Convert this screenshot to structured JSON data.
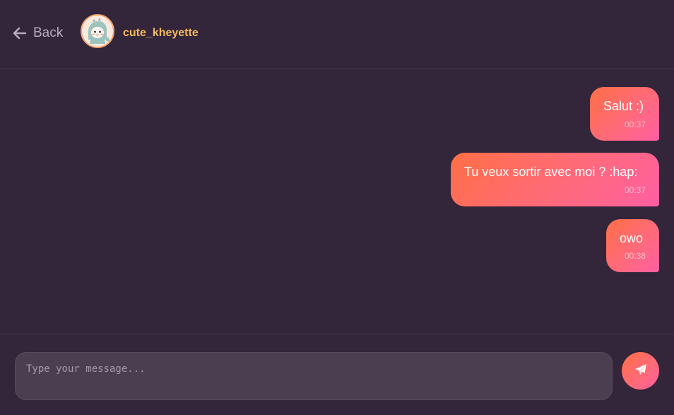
{
  "header": {
    "back_label": "Back",
    "username": "cute_kheyette"
  },
  "messages": [
    {
      "text": "Salut :)",
      "time": "00:37"
    },
    {
      "text": "Tu veux sortir avec moi ? :hap:",
      "time": "00:37"
    },
    {
      "text": "owo",
      "time": "00:38"
    }
  ],
  "composer": {
    "value": "",
    "placeholder": "Type your message..."
  },
  "icons": {
    "back": "arrow-left-icon",
    "send": "paper-plane-icon"
  },
  "colors": {
    "background": "#33253a",
    "username": "#f4b95f",
    "bubble_start": "#ff6f45",
    "bubble_end": "#ff5fa2"
  }
}
